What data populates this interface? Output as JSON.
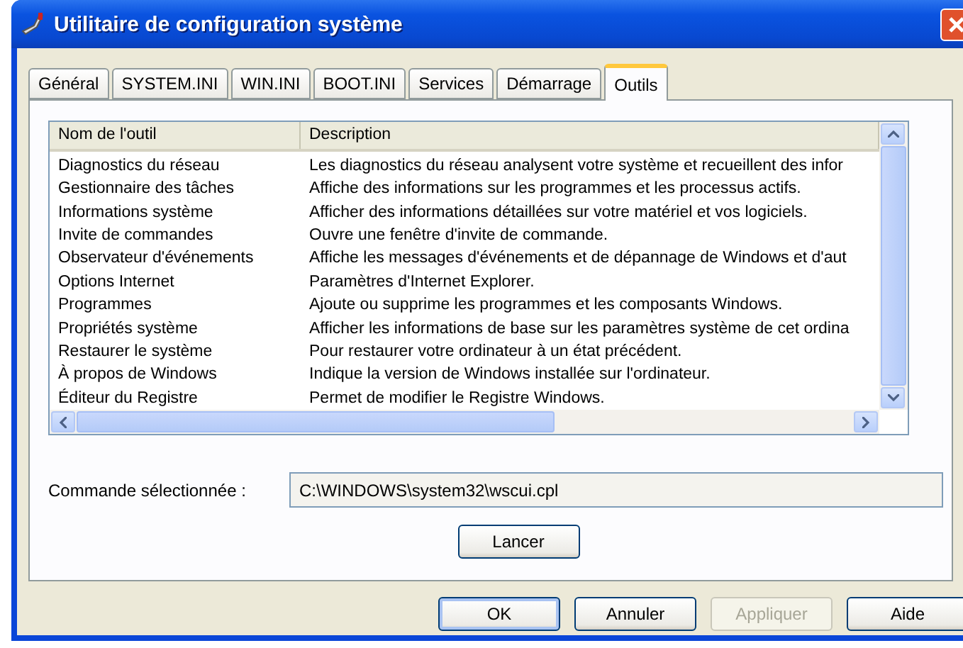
{
  "window": {
    "title": "Utilitaire de configuration système"
  },
  "tabs": [
    {
      "label": "Général",
      "selected": false
    },
    {
      "label": "SYSTEM.INI",
      "selected": false
    },
    {
      "label": "WIN.INI",
      "selected": false
    },
    {
      "label": "BOOT.INI",
      "selected": false
    },
    {
      "label": "Services",
      "selected": false
    },
    {
      "label": "Démarrage",
      "selected": false
    },
    {
      "label": "Outils",
      "selected": true
    }
  ],
  "tools": {
    "columns": [
      "Nom de l'outil",
      "Description"
    ],
    "rows": [
      {
        "name": "Diagnostics du réseau",
        "description": "Les diagnostics du réseau analysent votre système et recueillent des infor"
      },
      {
        "name": "Gestionnaire des tâches",
        "description": "Affiche des informations sur les programmes et les processus actifs."
      },
      {
        "name": "Informations système",
        "description": "Afficher des informations détaillées sur votre matériel et vos logiciels."
      },
      {
        "name": "Invite de commandes",
        "description": "Ouvre une fenêtre d'invite de commande."
      },
      {
        "name": "Observateur d'événements",
        "description": "Affiche les messages d'événements et de dépannage de Windows et d'aut"
      },
      {
        "name": "Options Internet",
        "description": "Paramètres d'Internet Explorer."
      },
      {
        "name": "Programmes",
        "description": "Ajoute ou supprime les programmes et les composants Windows."
      },
      {
        "name": "Propriétés système",
        "description": "Afficher les informations de base sur les paramètres système de cet ordina"
      },
      {
        "name": "Restaurer le système",
        "description": "Pour restaurer votre ordinateur à un état précédent."
      },
      {
        "name": "À propos de Windows",
        "description": "Indique la version de Windows installée sur l'ordinateur."
      },
      {
        "name": "Éditeur du Registre",
        "description": "Permet de modifier le Registre Windows."
      }
    ]
  },
  "command": {
    "label": "Commande sélectionnée :",
    "value": "C:\\WINDOWS\\system32\\wscui.cpl",
    "launch_button": "Lancer"
  },
  "buttons": [
    {
      "label": "OK",
      "disabled": false,
      "default": true
    },
    {
      "label": "Annuler",
      "disabled": false,
      "default": false
    },
    {
      "label": "Appliquer",
      "disabled": true,
      "default": false
    },
    {
      "label": "Aide",
      "disabled": false,
      "default": false
    }
  ]
}
